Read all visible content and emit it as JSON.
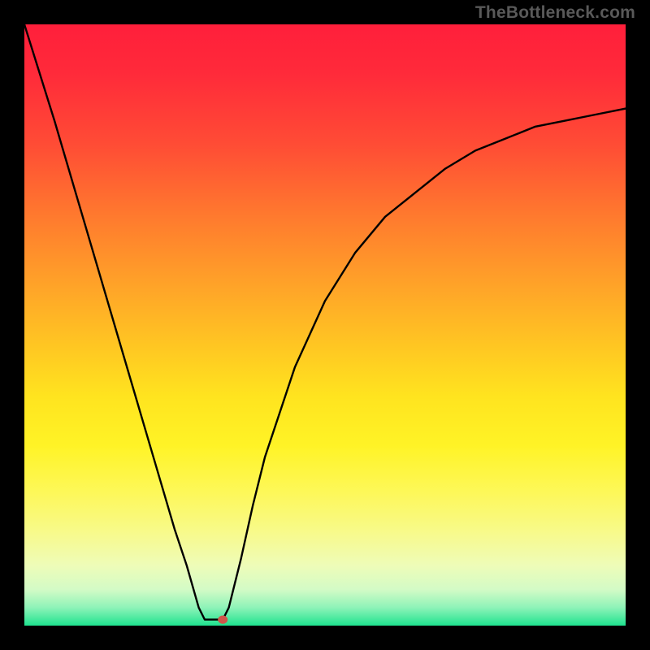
{
  "watermark": "TheBottleneck.com",
  "chart_data": {
    "type": "line",
    "title": "",
    "xlabel": "",
    "ylabel": "",
    "xlim": [
      0,
      100
    ],
    "ylim": [
      0,
      100
    ],
    "grid": false,
    "legend": false,
    "series": [
      {
        "name": "bottleneck-curve",
        "x": [
          0,
          5,
          10,
          15,
          20,
          25,
          27,
          29,
          30,
          31,
          32,
          33,
          34,
          36,
          38,
          40,
          45,
          50,
          55,
          60,
          65,
          70,
          75,
          80,
          85,
          90,
          95,
          100
        ],
        "values": [
          100,
          84,
          67,
          50,
          33,
          16,
          10,
          3,
          1,
          1,
          1,
          1,
          3,
          11,
          20,
          28,
          43,
          54,
          62,
          68,
          72,
          76,
          79,
          81,
          83,
          84,
          85,
          86
        ]
      }
    ],
    "marker": {
      "x": 33,
      "y": 1,
      "color": "#d0564a",
      "radius_px": 6
    },
    "background_gradient": {
      "orientation": "vertical",
      "stops": [
        {
          "pos": 0.0,
          "color": "#ff1f3b"
        },
        {
          "pos": 0.2,
          "color": "#ff4c35"
        },
        {
          "pos": 0.44,
          "color": "#ffa528"
        },
        {
          "pos": 0.62,
          "color": "#ffe41f"
        },
        {
          "pos": 0.85,
          "color": "#f7fa8f"
        },
        {
          "pos": 1.0,
          "color": "#1fe38f"
        }
      ]
    }
  }
}
